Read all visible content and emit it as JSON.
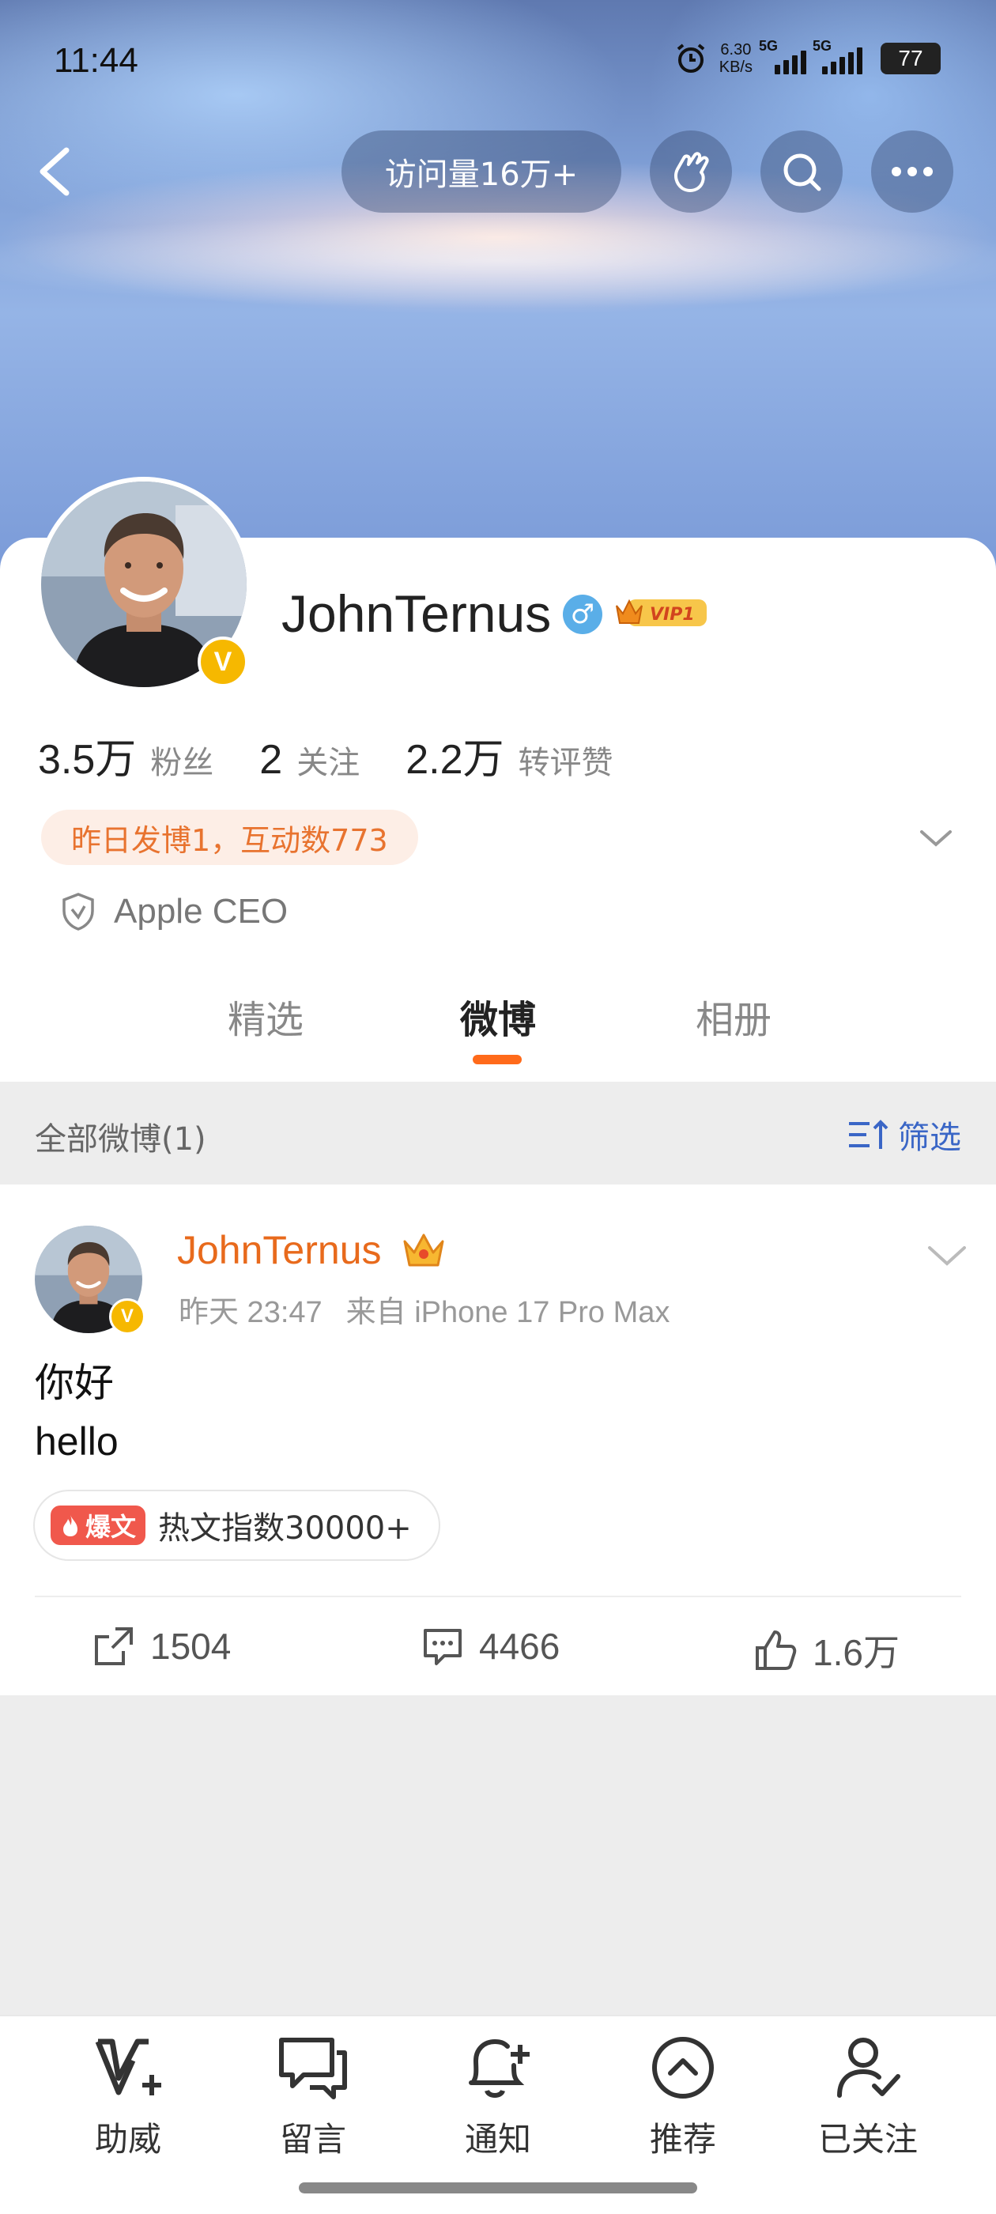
{
  "status_bar": {
    "time": "11:44",
    "net_speed_value": "6.30",
    "net_speed_unit": "KB/s",
    "sim1": "5G",
    "sim2": "5G",
    "battery": "77"
  },
  "top_nav": {
    "visits": "访问量16万+"
  },
  "profile": {
    "name": "JohnTernus",
    "gender_symbol": "♂",
    "vip_label": "VIP1",
    "verified_mark": "V",
    "stats": [
      {
        "value": "3.5万",
        "label": "粉丝"
      },
      {
        "value": "2",
        "label": "关注"
      },
      {
        "value": "2.2万",
        "label": "转评赞"
      }
    ],
    "activity": "昨日发博1，互动数773",
    "verification_text": "Apple CEO"
  },
  "tabs": [
    {
      "label": "精选",
      "active": false
    },
    {
      "label": "微博",
      "active": true
    },
    {
      "label": "相册",
      "active": false
    }
  ],
  "filter_bar": {
    "all_posts": "全部微博(1)",
    "filter": "筛选"
  },
  "post": {
    "author": "JohnTernus",
    "time": "昨天 23:47",
    "source": "来自 iPhone 17 Pro Max",
    "line1": "你好",
    "line2": "hello",
    "hot_tag": "爆文",
    "hot_text": "热文指数30000+",
    "reposts": "1504",
    "comments": "4466",
    "likes": "1.6万"
  },
  "bottom_nav": [
    {
      "label": "助威",
      "icon": "cheer-icon"
    },
    {
      "label": "留言",
      "icon": "message-icon"
    },
    {
      "label": "通知",
      "icon": "bell-plus-icon"
    },
    {
      "label": "推荐",
      "icon": "recommend-icon"
    },
    {
      "label": "已关注",
      "icon": "following-icon"
    }
  ],
  "colors": {
    "accent_orange": "#ff6a1a",
    "name_orange": "#e86a1c",
    "filter_blue": "#3a66c6",
    "vip_gold": "#f6b800",
    "hot_red": "#f0584c"
  }
}
